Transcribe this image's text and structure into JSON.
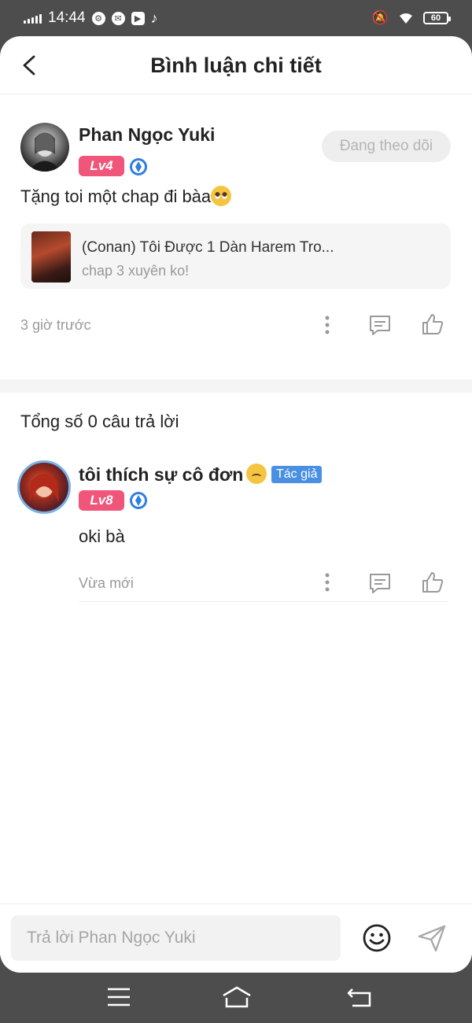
{
  "status_bar": {
    "time": "14:44",
    "battery": "60"
  },
  "header": {
    "title": "Bình luận chi tiết"
  },
  "comment": {
    "username": "Phan Ngọc Yuki",
    "level": "Lv4",
    "follow_label": "Đang theo dõi",
    "text": "Tặng toi một chap đi bàa",
    "story": {
      "title": "(Conan) Tôi Được 1 Dàn Harem Tro...",
      "subtitle": "chap 3 xuyên ko!"
    },
    "time": "3 giờ trước"
  },
  "replies": {
    "count_label": "Tổng số 0 câu trả lời",
    "items": [
      {
        "username": "tôi thích sự cô đơn",
        "author_tag": "Tác giả",
        "level": "Lv8",
        "text": "oki bà",
        "time": "Vừa mới"
      }
    ]
  },
  "input": {
    "placeholder": "Trả lời Phan Ngọc Yuki"
  },
  "colors": {
    "level_badge": "#f0557a",
    "author_tag": "#4a90e2",
    "follow_bg": "#eeeeee"
  }
}
